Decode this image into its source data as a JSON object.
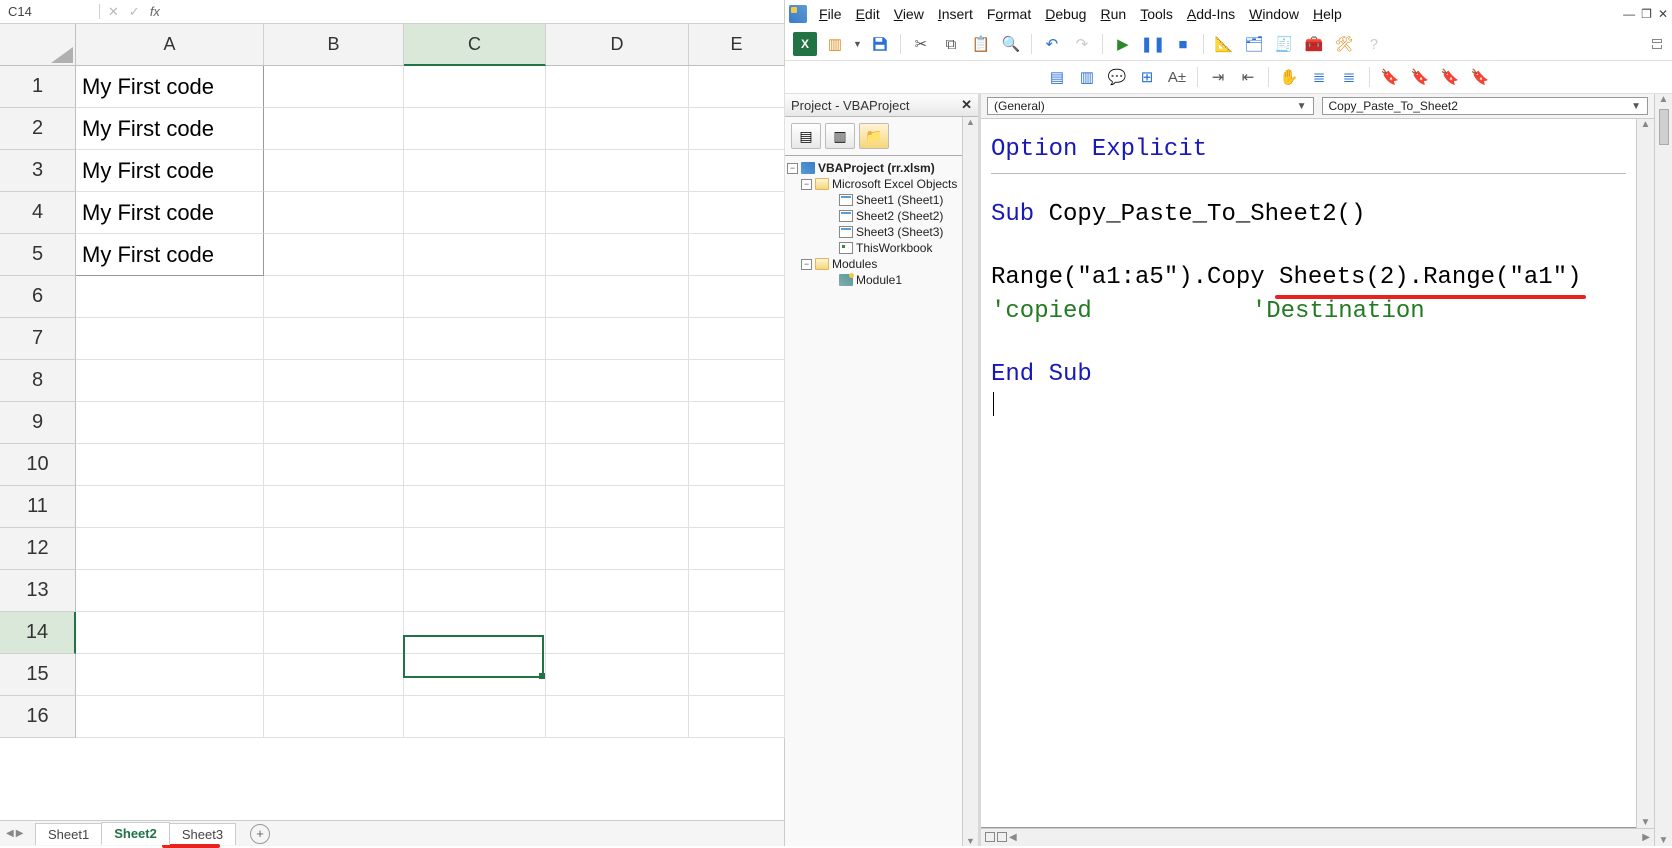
{
  "excel": {
    "nameBox": "C14",
    "fx": "fx",
    "columns": [
      "A",
      "B",
      "C",
      "D",
      "E"
    ],
    "rows": [
      "1",
      "2",
      "3",
      "4",
      "5",
      "6",
      "7",
      "8",
      "9",
      "10",
      "11",
      "12",
      "13",
      "14",
      "15",
      "16"
    ],
    "data": {
      "A1": "My First code",
      "A2": "My First code",
      "A3": "My First code",
      "A4": "My First code",
      "A5": "My First code"
    },
    "activeCell": "C14",
    "tabs": [
      "Sheet1",
      "Sheet2",
      "Sheet3"
    ],
    "activeTab": "Sheet2"
  },
  "vba": {
    "menus": [
      "File",
      "Edit",
      "View",
      "Insert",
      "Format",
      "Debug",
      "Run",
      "Tools",
      "Add-Ins",
      "Window",
      "Help"
    ],
    "projectPanelTitle": "Project - VBAProject",
    "tree": {
      "project": "VBAProject (rr.xlsm)",
      "excelObjects": "Microsoft Excel Objects",
      "sheets": [
        "Sheet1 (Sheet1)",
        "Sheet2 (Sheet2)",
        "Sheet3 (Sheet3)"
      ],
      "thisWorkbook": "ThisWorkbook",
      "modulesFolder": "Modules",
      "module": "Module1"
    },
    "dropdownLeft": "(General)",
    "dropdownRight": "Copy_Paste_To_Sheet2",
    "code": {
      "optionExplicit": "Option Explicit",
      "subLine1": "Sub",
      "subLine2": " Copy_Paste_To_Sheet2()",
      "rangeCopy1": "Range(\"a1:a5\").Copy ",
      "rangeCopy2": "Sheets(2).Range(\"a1\")",
      "commentCopied": "'copied",
      "commentDest": "'Destination",
      "endSub": "End Sub"
    }
  }
}
